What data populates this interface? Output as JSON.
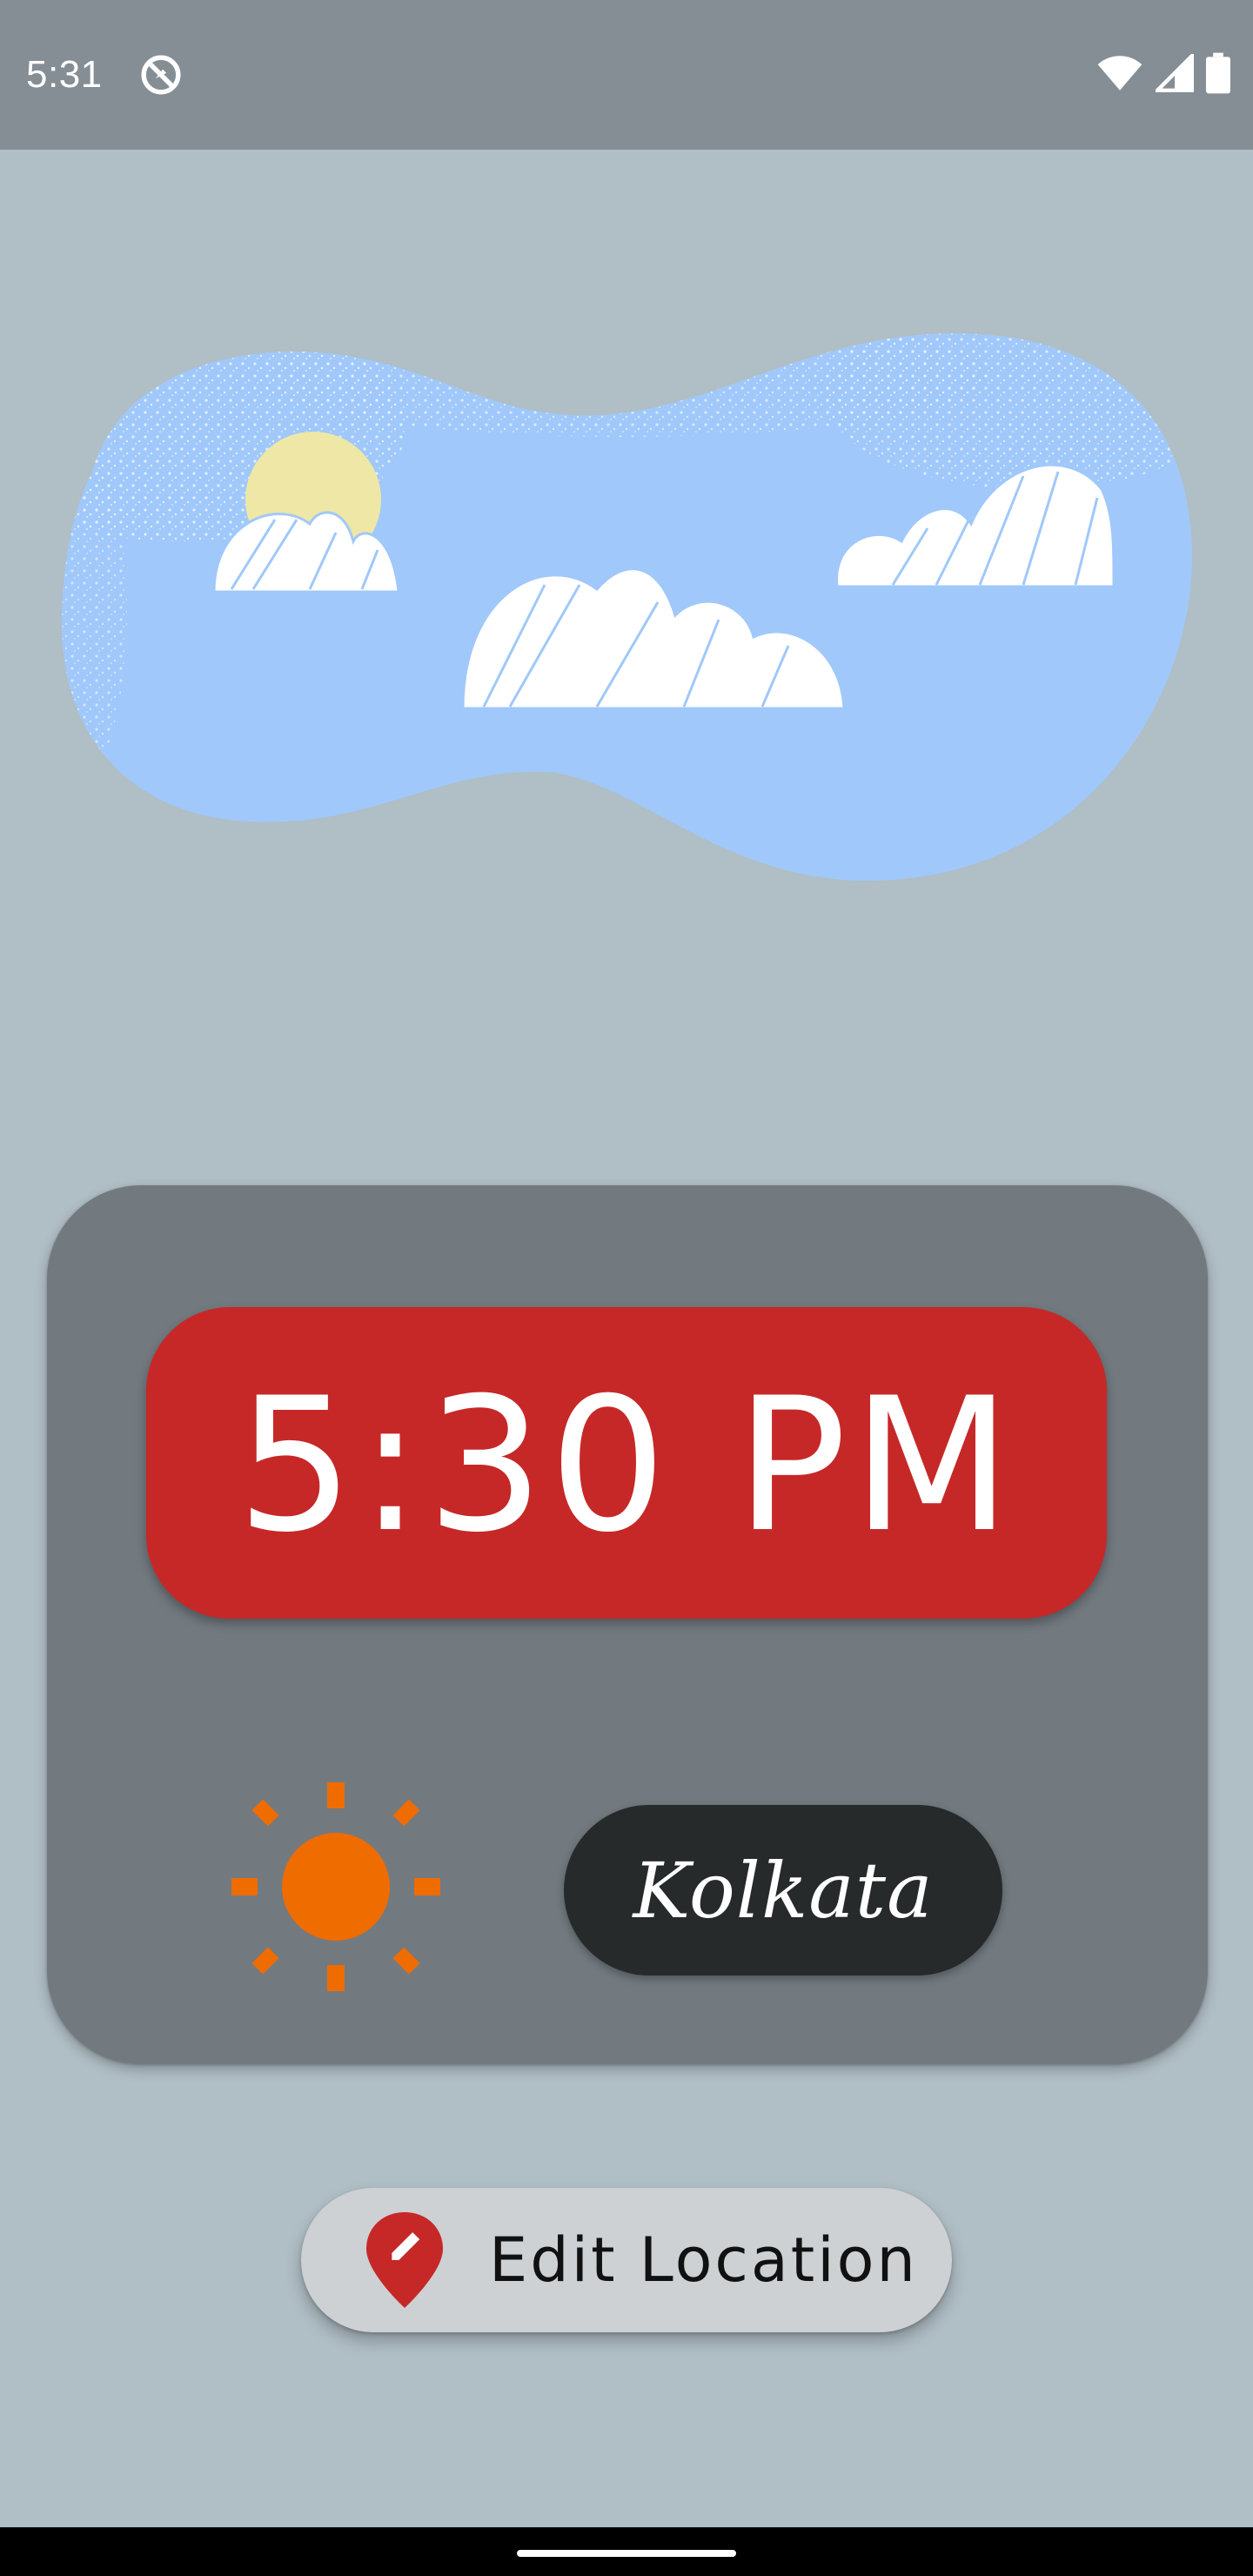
{
  "status_bar": {
    "time": "5:31",
    "icons": [
      "do-not-disturb-icon",
      "wifi-icon",
      "cellular-signal-icon",
      "battery-icon"
    ]
  },
  "illustration": {
    "description_icon": "sky-clouds-illustration"
  },
  "card": {
    "time": "5:30 PM",
    "weather_icon": "sun-icon",
    "city": "Kolkata"
  },
  "edit_location": {
    "icon": "location-edit-icon",
    "label": "Edit Location"
  },
  "colors": {
    "background": "#b0bec5",
    "status_bar": "#868e95",
    "card": "#727a80",
    "time_pill": "#c62828",
    "city_pill": "#262a2b",
    "sun": "#ef6c00",
    "sky": "#a0c8fa",
    "button": "#cdd1d4"
  }
}
